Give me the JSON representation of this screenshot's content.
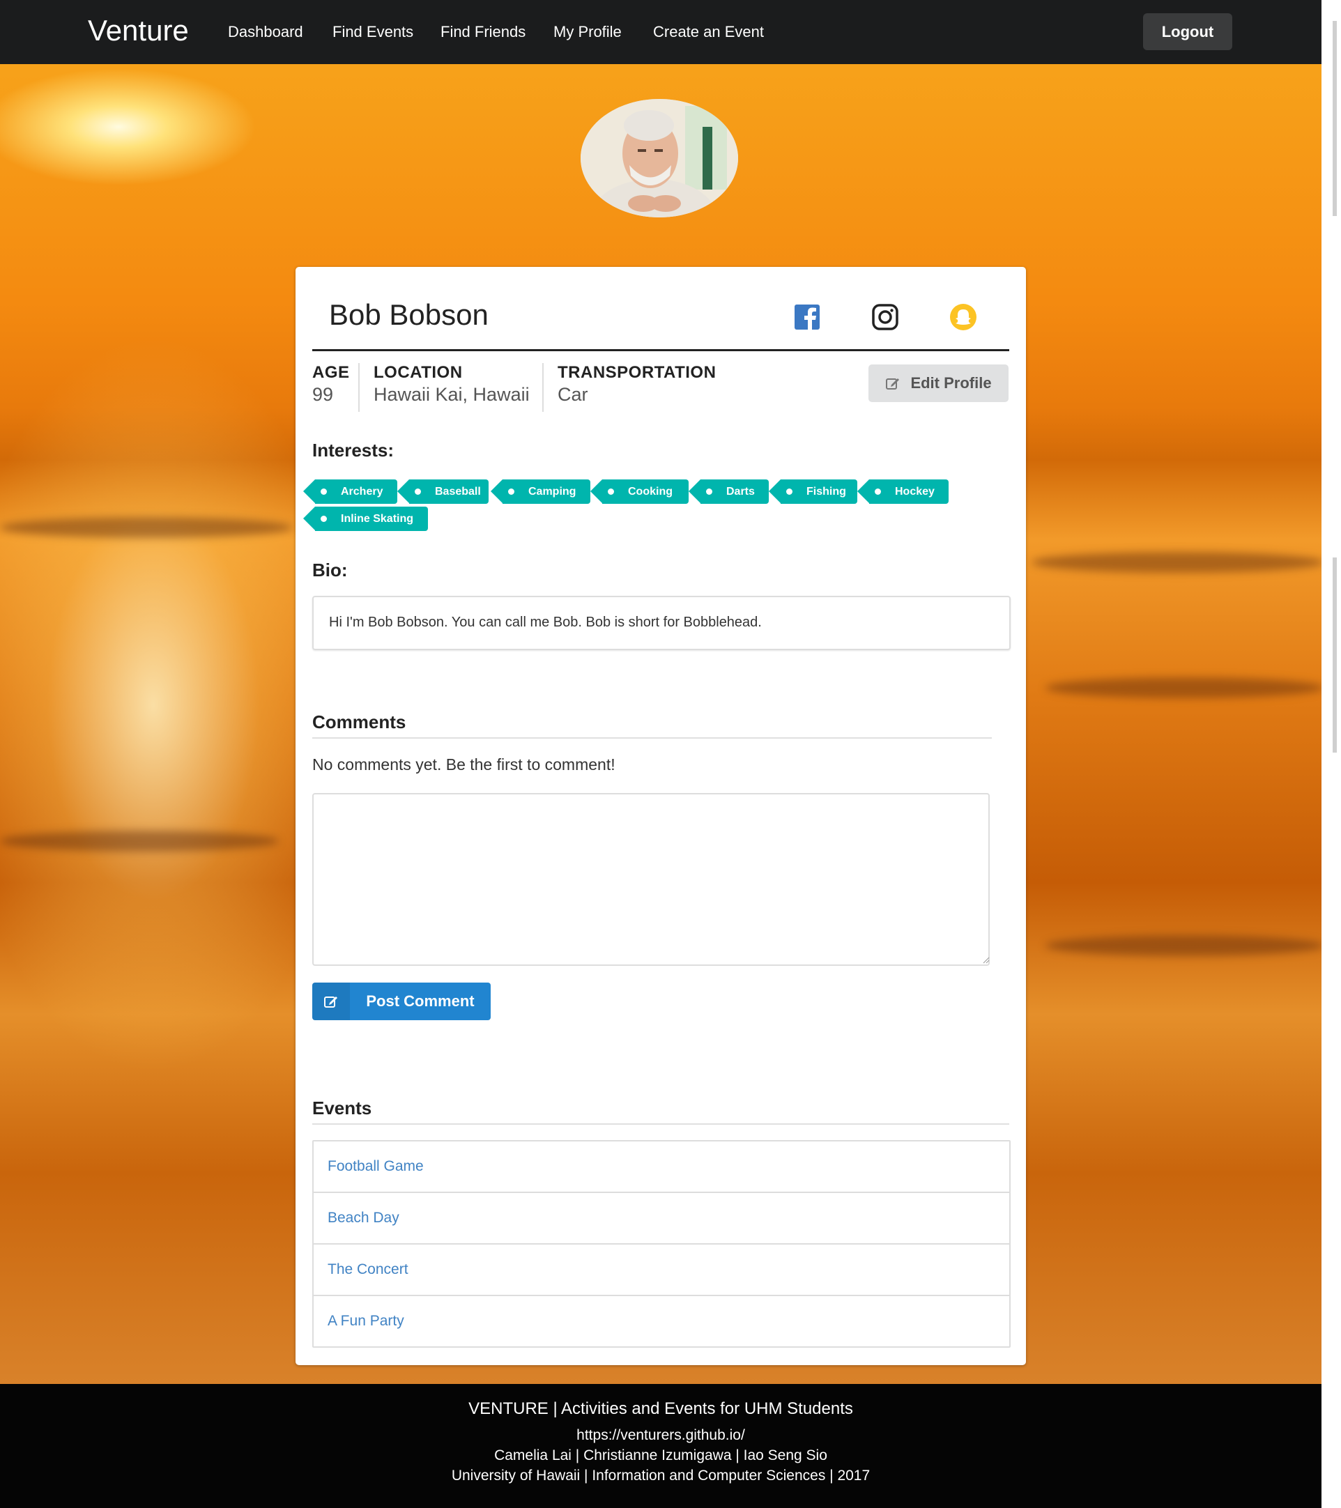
{
  "navbar": {
    "brand": "Venture",
    "links": [
      "Dashboard",
      "Find Events",
      "Find Friends",
      "My Profile",
      "Create an Event"
    ],
    "logout": "Logout"
  },
  "profile": {
    "name": "Bob Bobson",
    "social_icons": [
      "facebook-icon",
      "instagram-icon",
      "snapchat-icon"
    ],
    "stats": {
      "age_label": "AGE",
      "age": "99",
      "location_label": "LOCATION",
      "location": "Hawaii Kai, Hawaii",
      "transportation_label": "TRANSPORTATION",
      "transportation": "Car"
    },
    "edit_button": "Edit Profile",
    "interests_heading": "Interests:",
    "interests": [
      "Archery",
      "Baseball",
      "Camping",
      "Cooking",
      "Darts",
      "Fishing",
      "Hockey",
      "Inline Skating"
    ],
    "bio_heading": "Bio:",
    "bio": "Hi I'm Bob Bobson. You can call me Bob. Bob is short for Bobblehead."
  },
  "comments": {
    "heading": "Comments",
    "empty_text": "No comments yet. Be the first to comment!",
    "input_value": "",
    "post_button": "Post Comment"
  },
  "events": {
    "heading": "Events",
    "items": [
      "Football Game",
      "Beach Day",
      "The Concert",
      "A Fun Party"
    ]
  },
  "footer": {
    "line1": "VENTURE | Activities and Events for UHM Students",
    "line2": "https://venturers.github.io/",
    "line3": "Camelia Lai | Christianne Izumigawa | Iao Seng Sio",
    "line4": "University of Hawaii | Information and Computer Sciences | 2017"
  },
  "colors": {
    "navbar": "#1b1c1d",
    "tag": "#00b5ad",
    "primary": "#2185d0",
    "link": "#4183c4",
    "snapchat": "#fcc324",
    "facebook": "#3b78c3"
  }
}
